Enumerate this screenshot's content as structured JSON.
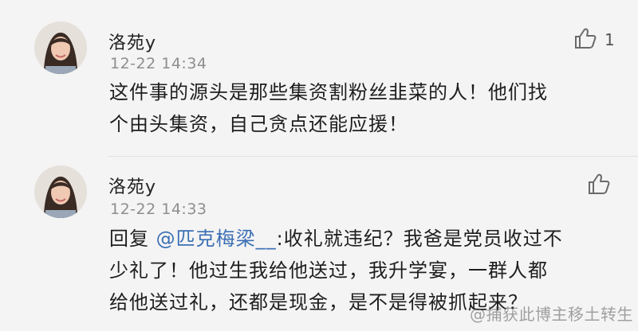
{
  "comments": [
    {
      "username": "洛苑y",
      "timestamp": "12-22 14:34",
      "like_count": "1",
      "text_lines": [
        "这件事的源头是那些集资割粉丝韭菜的人！他们找",
        "个由头集资，自己贪点还能应援！"
      ]
    },
    {
      "username": "洛苑y",
      "timestamp": "12-22 14:33",
      "like_count": "",
      "reply_prefix": "回复",
      "mention": "@匹克梅梁__",
      "text_after_mention": ":收礼就违纪？我爸是党员收过不",
      "text_lines": [
        "少礼了！他过生我给他送过，我升学宴，一群人都",
        "给他送过礼，还都是现金，是不是得被抓起来？"
      ]
    }
  ],
  "watermark": "@捕获此博主移土转生",
  "icons": {
    "like": "thumbs-up-icon",
    "avatar": "user-avatar"
  }
}
